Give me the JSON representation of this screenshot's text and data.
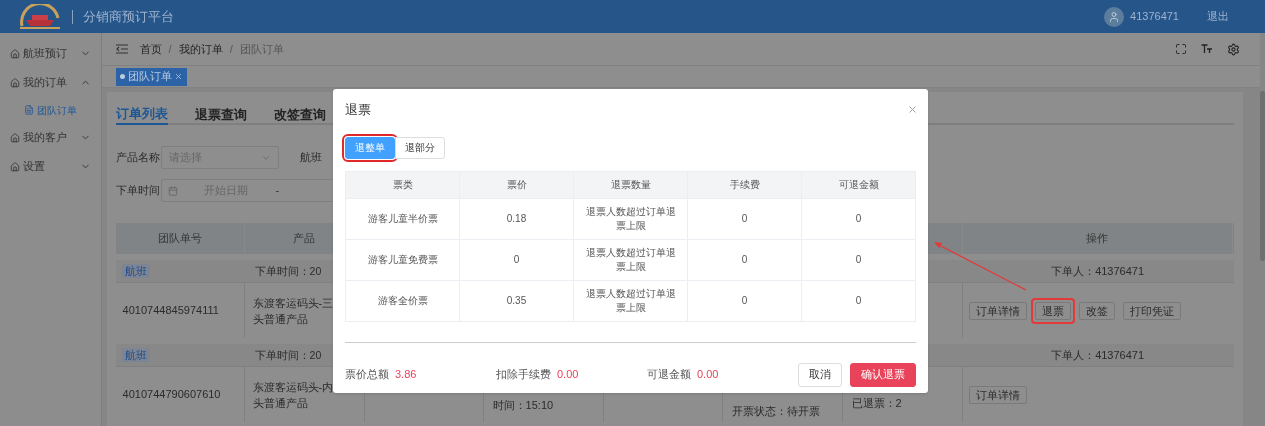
{
  "header": {
    "title": "分销商预订平台",
    "user": "41376471",
    "logout": "退出"
  },
  "sidebar": {
    "items": [
      {
        "label": "航班预订",
        "expanded": false
      },
      {
        "label": "我的订单",
        "expanded": true,
        "children": [
          {
            "label": "团队订单",
            "selected": true
          }
        ]
      },
      {
        "label": "我的客户",
        "expanded": false
      },
      {
        "label": "设置",
        "expanded": false
      }
    ]
  },
  "breadcrumb": [
    {
      "kind": "link",
      "label": "首页"
    },
    {
      "kind": "separator",
      "label": "/"
    },
    {
      "kind": "link",
      "label": "我的订单"
    },
    {
      "kind": "separator",
      "label": "/"
    },
    {
      "kind": "current",
      "label": "团队订单"
    }
  ],
  "tags": [
    {
      "label": "团队订单",
      "active": true
    }
  ],
  "page_tabs": [
    {
      "label": "订单列表",
      "selected": true
    },
    {
      "label": "退票查询",
      "selected": false
    },
    {
      "label": "改签查询",
      "selected": false
    }
  ],
  "filter_rows": [
    [
      {
        "kind": "select",
        "label": "产品名称",
        "placeholder": "请选择"
      },
      {
        "kind": "label",
        "label": "航班"
      }
    ],
    [
      {
        "kind": "date",
        "label": "下单时间",
        "placeholder": "开始日期",
        "separator": "-"
      }
    ]
  ],
  "orders_table": {
    "columns": [
      {
        "label": "团队单号"
      },
      {
        "label": "产品"
      },
      {
        "label": "操作"
      }
    ],
    "groups": [
      {
        "tag": "航班",
        "order_time": "下单时间：20",
        "orderer": "下单人：41376471",
        "id": "4010744845974111",
        "product": [
          "东渡客运码头-三",
          "头普通产品"
        ],
        "actions": [
          {
            "label": "订单详情",
            "highlighted": false
          },
          {
            "label": "退票",
            "highlighted": true
          },
          {
            "label": "改签",
            "highlighted": false
          },
          {
            "label": "打印凭证",
            "highlighted": false
          }
        ]
      },
      {
        "tag": "航班",
        "order_time": "下单时间：20",
        "orderer": "下单人：41376471",
        "id": "4010744790607610",
        "product": [
          "东渡客运码头-内",
          "头普通产品"
        ],
        "time": "时间：15:10",
        "status": "开票状态：待开票",
        "refunded": "已退票：2",
        "actions": [
          {
            "label": "订单详情",
            "highlighted": false
          }
        ]
      }
    ]
  },
  "dialog": {
    "title": "退票",
    "segments": [
      {
        "label": "退整单",
        "selected": true,
        "highlighted": true
      },
      {
        "label": "退部分",
        "selected": false,
        "highlighted": false
      }
    ],
    "columns": [
      "票类",
      "票价",
      "退票数量",
      "手续费",
      "可退金额"
    ],
    "rows": [
      [
        "游客儿童半价票",
        "0.18",
        "退票人数超过订单退票上限",
        "0",
        "0"
      ],
      [
        "游客儿童免费票",
        "0",
        "退票人数超过订单退票上限",
        "0",
        "0"
      ],
      [
        "游客全价票",
        "0.35",
        "退票人数超过订单退票上限",
        "0",
        "0"
      ]
    ],
    "summary": [
      {
        "label": "票价总额",
        "value": "3.86"
      },
      {
        "label": "扣除手续费",
        "value": "0.00"
      },
      {
        "label": "可退金额",
        "value": "0.00"
      }
    ],
    "buttons": [
      {
        "label": "取消",
        "kind": "secondary"
      },
      {
        "label": "确认退票",
        "kind": "primary"
      }
    ]
  }
}
